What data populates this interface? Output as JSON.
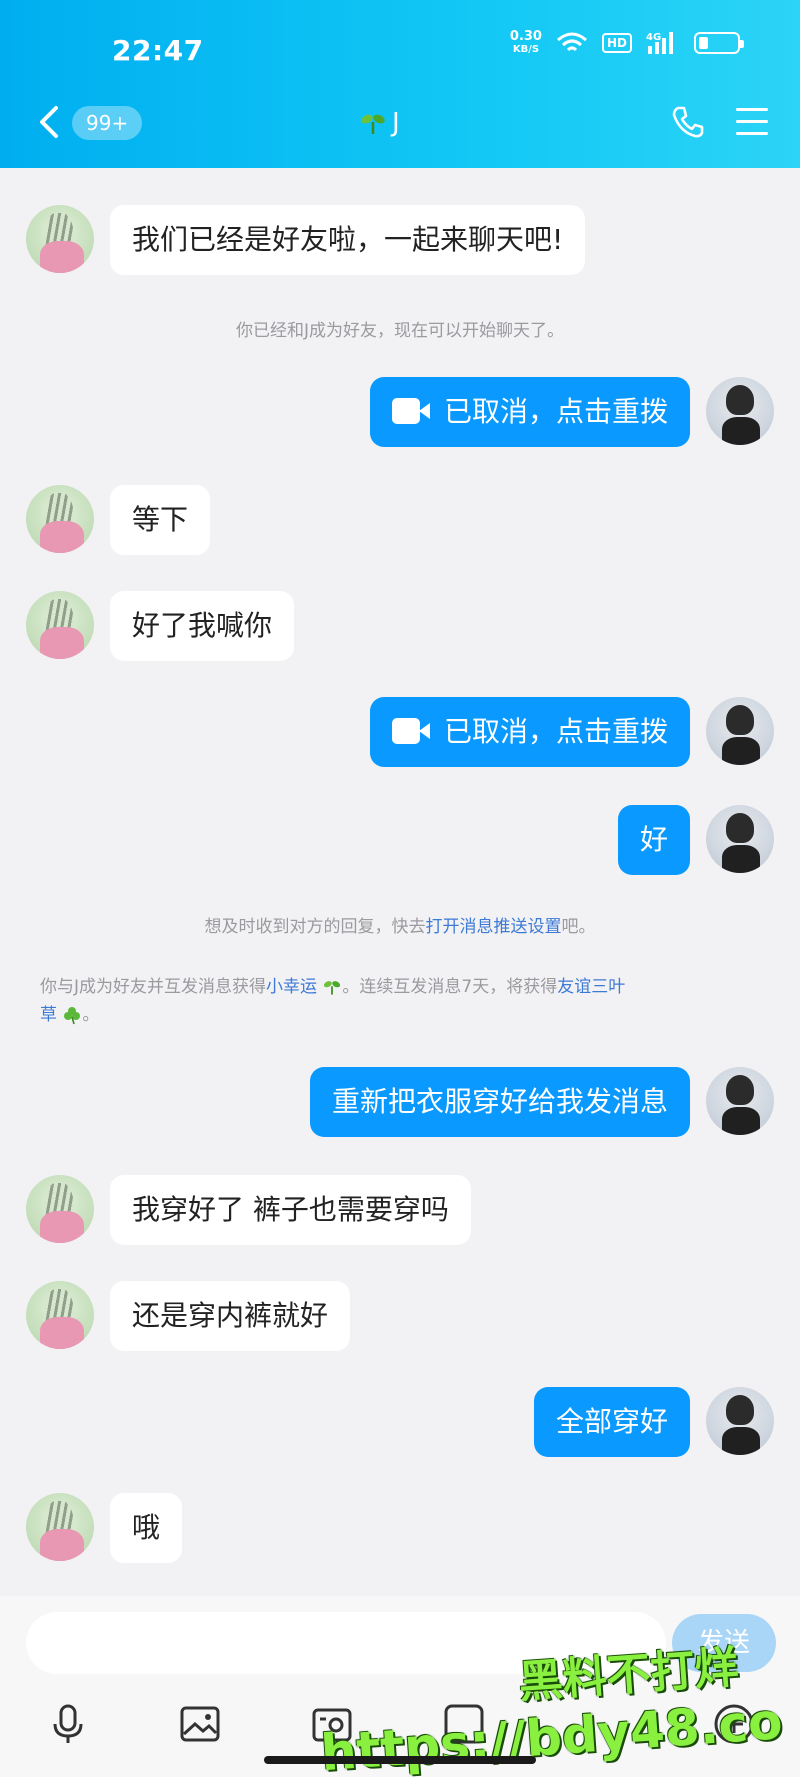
{
  "status_bar": {
    "time": "22:47",
    "net_speed": "0.30",
    "net_unit": "KB/S",
    "hd": "HD",
    "signal": "4G",
    "battery_level": 0.25
  },
  "header": {
    "unread_badge": "99+",
    "title": "J",
    "title_icon": "sprout-icon"
  },
  "messages": [
    {
      "side": "in",
      "text": "我们已经是好友啦，一起来聊天吧!"
    },
    {
      "side": "sys",
      "text": "你已经和J成为好友，现在可以开始聊天了。"
    },
    {
      "side": "out",
      "type": "video_call",
      "text": "已取消，点击重拨"
    },
    {
      "side": "in",
      "text": "等下"
    },
    {
      "side": "in",
      "text": "好了我喊你"
    },
    {
      "side": "out",
      "type": "video_call",
      "text": "已取消，点击重拨"
    },
    {
      "side": "out",
      "text": "好"
    },
    {
      "side": "sys",
      "text_prefix": "想及时收到对方的回复，快去",
      "link": "打开消息推送设置",
      "text_suffix": "吧。"
    },
    {
      "side": "sys",
      "line1_prefix": "你与J成为好友并互发消息获得",
      "link1": "小幸运",
      "line1_mid": "。连续互发消息7天，将获得",
      "link2": "友谊三叶",
      "line2_link": "草",
      "line2_suffix": "。"
    },
    {
      "side": "out",
      "text": "重新把衣服穿好给我发消息"
    },
    {
      "side": "in",
      "text": "我穿好了  裤子也需要穿吗"
    },
    {
      "side": "in",
      "text": "还是穿内裤就好"
    },
    {
      "side": "out",
      "text": "全部穿好"
    },
    {
      "side": "in",
      "text": "哦"
    }
  ],
  "input": {
    "placeholder": "",
    "send_label": "发送"
  },
  "toolbar": [
    "mic-icon",
    "image-icon",
    "camera-icon",
    "emoji-icon",
    "plus-icon"
  ],
  "watermark": {
    "line1": "黑料不打烊",
    "line2": "https://bdy48.co"
  },
  "colors": {
    "header": "#00aef0",
    "outgoing_bubble": "#0a99ff",
    "link": "#3d7ad6",
    "send_button": "#a9d6f7"
  }
}
